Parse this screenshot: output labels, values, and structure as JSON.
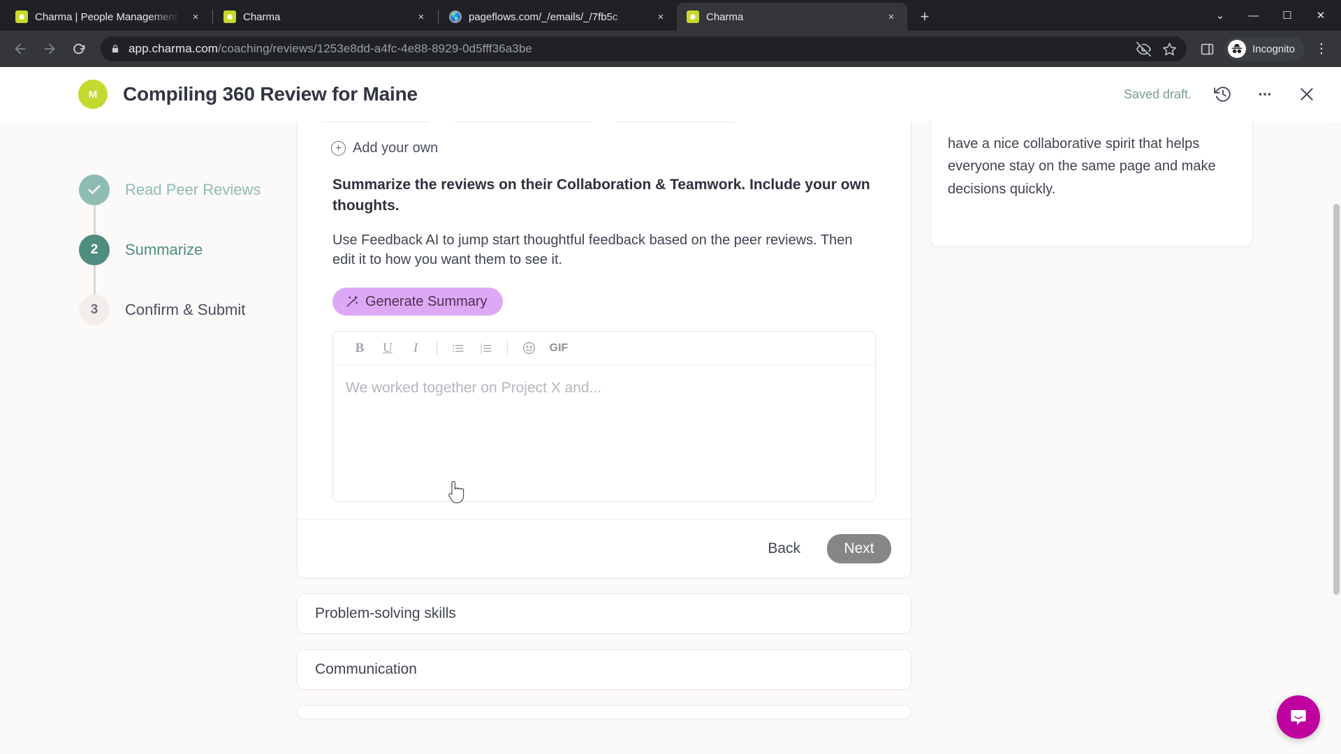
{
  "browser": {
    "tabs": [
      {
        "title": "Charma | People Management S",
        "favicon": "charma-favicon",
        "close_label": "×",
        "active": false
      },
      {
        "title": "Charma",
        "favicon": "charma-favicon",
        "close_label": "×",
        "active": false
      },
      {
        "title": "pageflows.com/_/emails/_/7fb5c",
        "favicon": "globe-favicon",
        "close_label": "×",
        "active": false
      },
      {
        "title": "Charma",
        "favicon": "charma-favicon",
        "close_label": "×",
        "active": true
      }
    ],
    "new_tab_label": "+",
    "window_controls": {
      "minimize": "—",
      "maximize": "☐",
      "close": "✕",
      "tab_search": "⌄"
    },
    "toolbar": {
      "back_label": "←",
      "forward_label": "→",
      "reload_label": "⟳",
      "url_host": "app.charma.com",
      "url_path": "/coaching/reviews/1253e8dd-a4fc-4e88-8929-0d5fff36a3be",
      "lock_icon": "lock-icon",
      "hidden_icon": "eye-off-icon",
      "bookmark_icon": "star-icon",
      "sidepanel_icon": "side-panel-icon",
      "profile_label": "Incognito",
      "menu_label": "⋮"
    }
  },
  "app": {
    "header": {
      "avatar_initial": "M",
      "title": "Compiling 360 Review for Maine",
      "saved_status": "Saved draft.",
      "history_icon": "history-icon",
      "more_icon": "more-horizontal-icon",
      "close_icon": "close-icon"
    },
    "stepper": [
      {
        "number": "✓",
        "label": "Read Peer Reviews",
        "state": "done"
      },
      {
        "number": "2",
        "label": "Summarize",
        "state": "current"
      },
      {
        "number": "3",
        "label": "Confirm & Submit",
        "state": "todo"
      }
    ],
    "main": {
      "add_your_own": "Add your own",
      "add_icon": "plus-circle-icon",
      "prompt_question": "Summarize the reviews on their Collaboration & Teamwork. Include your own thoughts.",
      "prompt_help": "Use Feedback AI to jump start thoughtful feedback based on the peer reviews. Then edit it to how you want them to see it.",
      "generate_button": "Generate Summary",
      "generate_icon": "magic-wand-icon",
      "editor": {
        "toolbar": [
          {
            "name": "bold-button",
            "label": "B",
            "style": "bold"
          },
          {
            "name": "underline-button",
            "label": "U",
            "style": "under"
          },
          {
            "name": "italic-button",
            "label": "I",
            "style": "ital"
          },
          {
            "name": "bulleted-list-button",
            "label": "☰",
            "style": "list"
          },
          {
            "name": "numbered-list-button",
            "label": "☰",
            "style": "list"
          },
          {
            "name": "emoji-button",
            "label": "☺",
            "style": "emoji"
          },
          {
            "name": "gif-button",
            "label": "GIF",
            "style": "gif"
          }
        ],
        "placeholder": "We worked together on Project X and..."
      },
      "back_button": "Back",
      "next_button": "Next"
    },
    "accordions": [
      {
        "title": "Problem-solving skills"
      },
      {
        "title": "Communication"
      }
    ],
    "peer_review": {
      "text": "have a nice collaborative spirit that helps everyone stay on the same page and make decisions quickly."
    },
    "support_widget": {
      "icon": "intercom-chat-icon"
    }
  },
  "colors": {
    "brand_green": "#c3d92f",
    "step_done": "#8dbdb2",
    "step_current": "#4e8d80",
    "generate_purple": "#dda8f5",
    "next_gray": "#868686",
    "intercom_magenta": "#bf01a0",
    "page_bg": "#fcf9f9"
  }
}
